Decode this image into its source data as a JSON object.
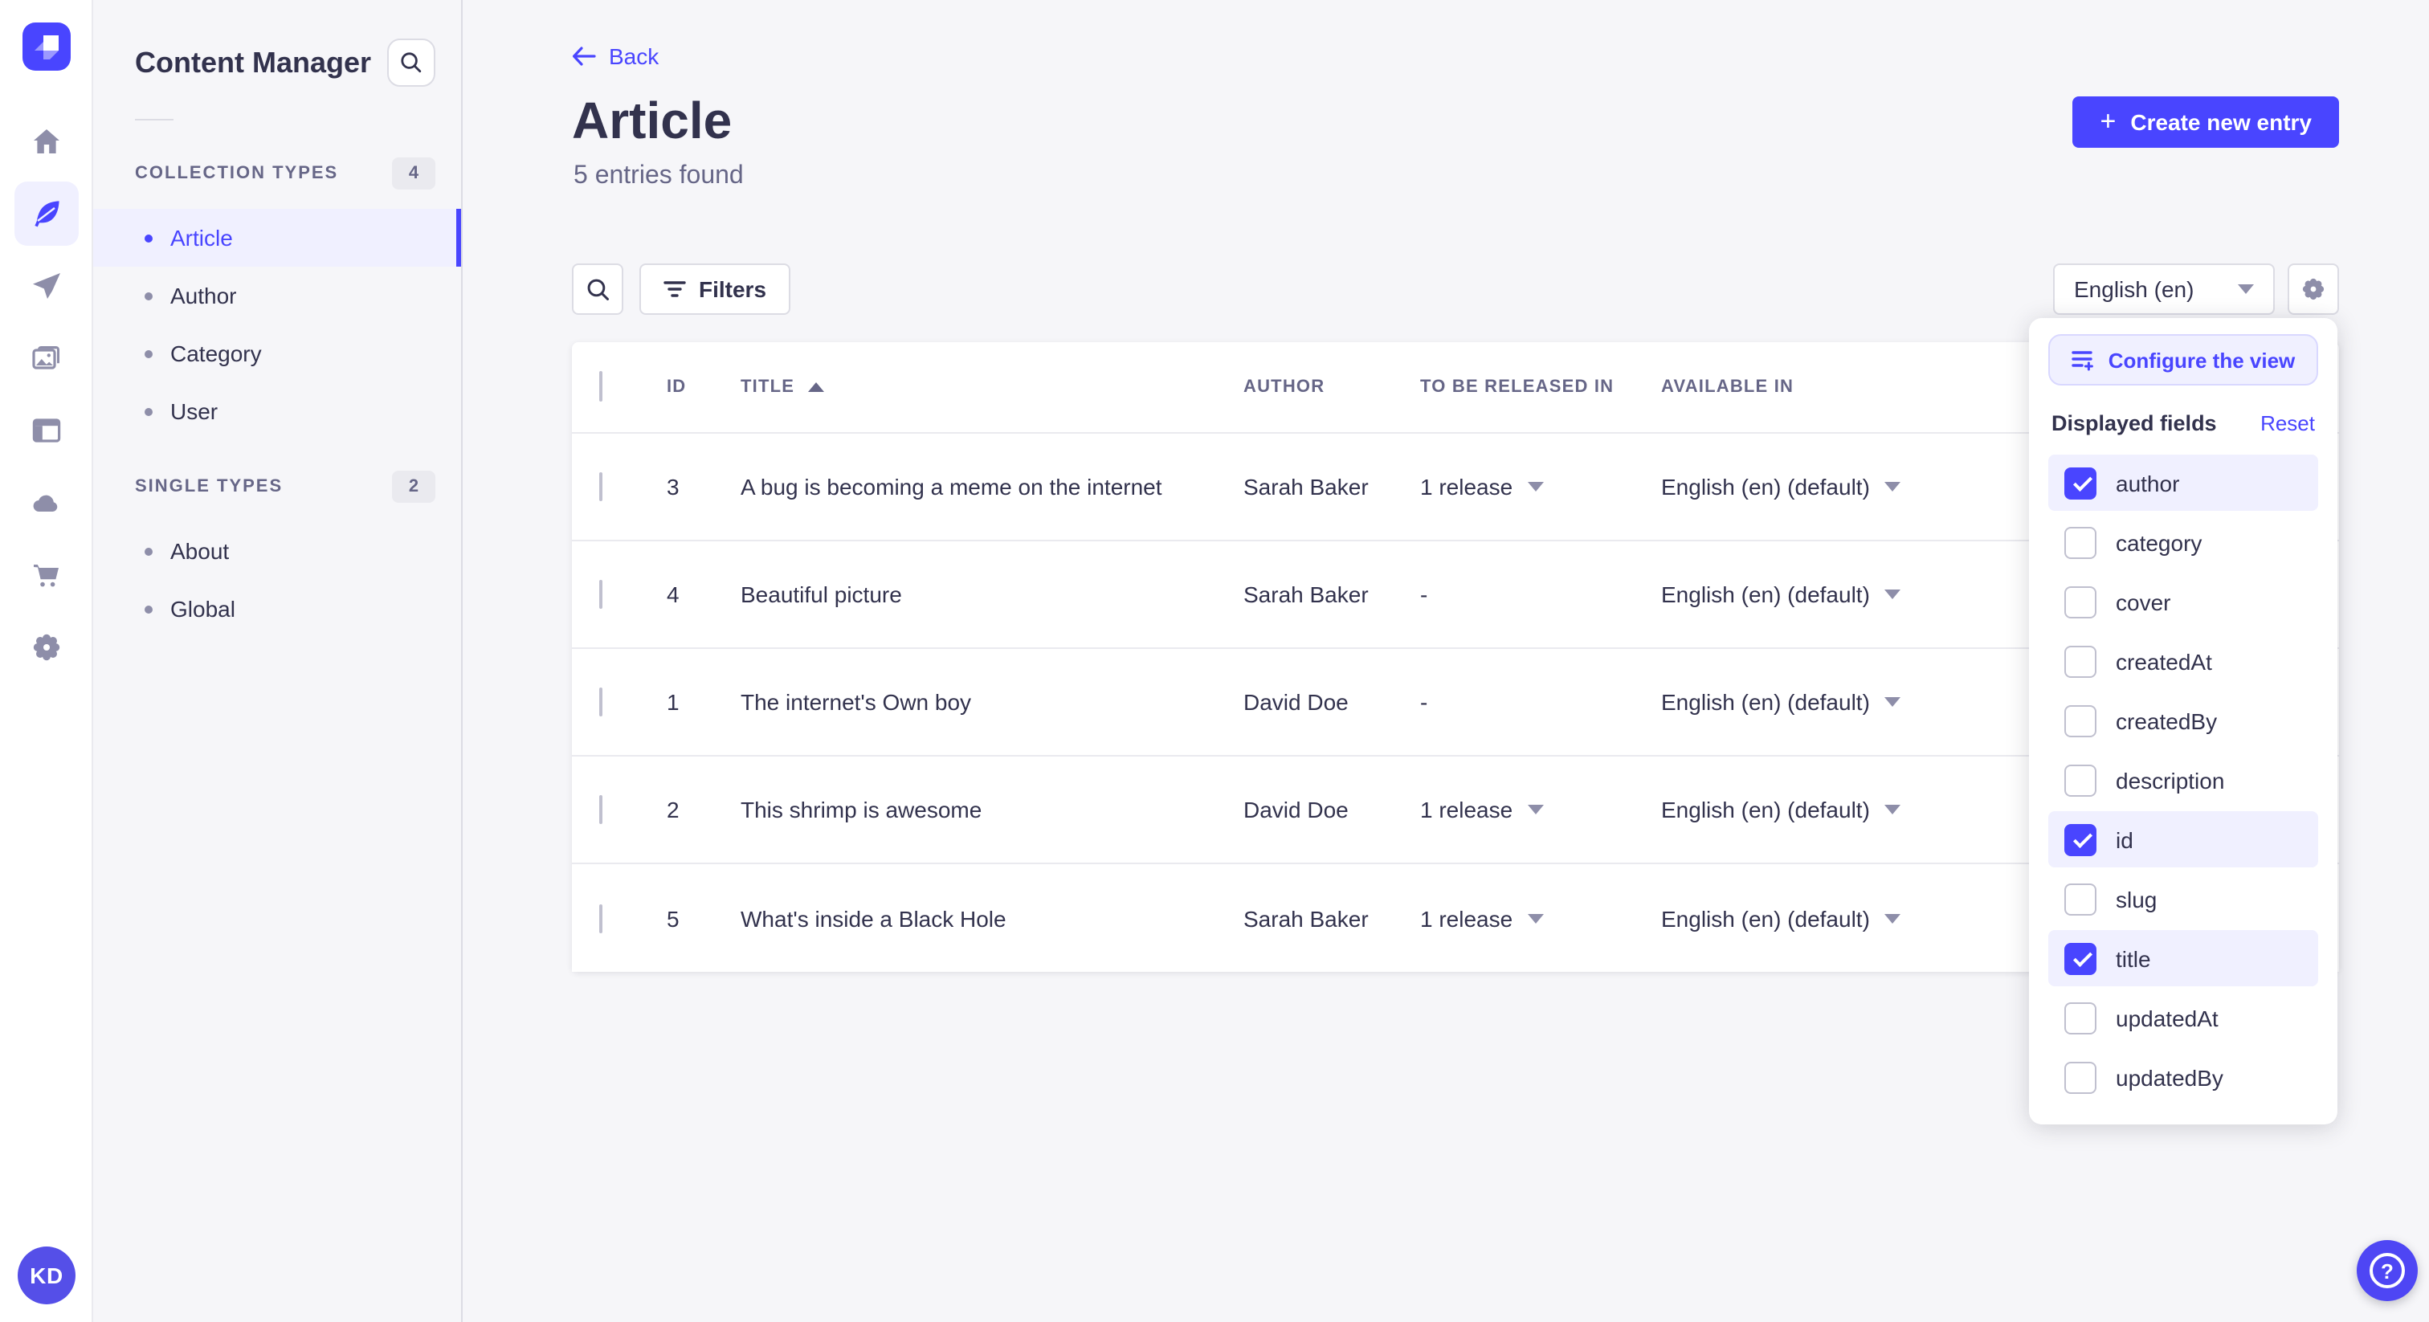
{
  "app": {
    "colors": {
      "primary": "#4945FF",
      "primary_light": "#F0F0FF",
      "text_dark": "#32324D",
      "text_muted": "#666687",
      "icon_gray": "#8E8EA9",
      "background": "#F6F6F9",
      "border": "#DCDCE4"
    }
  },
  "nav_rail": {
    "logo_icon": "strapi-logo",
    "items": [
      {
        "icon": "home-icon",
        "active": false
      },
      {
        "icon": "content-manager-feather-icon",
        "active": true
      },
      {
        "icon": "releases-paper-plane-icon",
        "active": false
      },
      {
        "icon": "media-library-icon",
        "active": false
      },
      {
        "icon": "content-type-builder-icon",
        "active": false
      },
      {
        "icon": "cloud-icon",
        "active": false
      },
      {
        "icon": "marketplace-cart-icon",
        "active": false
      },
      {
        "icon": "settings-gear-icon",
        "active": false
      }
    ],
    "avatar_initials": "KD"
  },
  "sidebar": {
    "title": "Content Manager",
    "sections": [
      {
        "label": "COLLECTION TYPES",
        "count": "4",
        "items": [
          {
            "label": "Article",
            "active": true
          },
          {
            "label": "Author",
            "active": false
          },
          {
            "label": "Category",
            "active": false
          },
          {
            "label": "User",
            "active": false
          }
        ]
      },
      {
        "label": "SINGLE TYPES",
        "count": "2",
        "items": [
          {
            "label": "About",
            "active": false
          },
          {
            "label": "Global",
            "active": false
          }
        ]
      }
    ]
  },
  "page": {
    "back_label": "Back",
    "title": "Article",
    "subtitle": "5 entries found",
    "create_button_label": "Create new entry"
  },
  "toolbar": {
    "filters_label": "Filters",
    "locale_value": "English (en)"
  },
  "table": {
    "columns": [
      "ID",
      "TITLE",
      "AUTHOR",
      "TO BE RELEASED IN",
      "AVAILABLE IN"
    ],
    "sorted_column": "TITLE",
    "sort_direction": "ascending",
    "rows": [
      {
        "id": "3",
        "title": "A bug is becoming a meme on the internet",
        "author": "Sarah Baker",
        "released_in": "1 release",
        "has_release": true,
        "available_in": "English (en) (default)"
      },
      {
        "id": "4",
        "title": "Beautiful picture",
        "author": "Sarah Baker",
        "released_in": "-",
        "has_release": false,
        "available_in": "English (en) (default)"
      },
      {
        "id": "1",
        "title": "The internet's Own boy",
        "author": "David Doe",
        "released_in": "-",
        "has_release": false,
        "available_in": "English (en) (default)"
      },
      {
        "id": "2",
        "title": "This shrimp is awesome",
        "author": "David Doe",
        "released_in": "1 release",
        "has_release": true,
        "available_in": "English (en) (default)"
      },
      {
        "id": "5",
        "title": "What's inside a Black Hole",
        "author": "Sarah Baker",
        "released_in": "1 release",
        "has_release": true,
        "available_in": "English (en) (default)"
      }
    ]
  },
  "popover": {
    "configure_button_label": "Configure the view",
    "section_title": "Displayed fields",
    "reset_label": "Reset",
    "fields": [
      {
        "label": "author",
        "checked": true
      },
      {
        "label": "category",
        "checked": false
      },
      {
        "label": "cover",
        "checked": false
      },
      {
        "label": "createdAt",
        "checked": false
      },
      {
        "label": "createdBy",
        "checked": false
      },
      {
        "label": "description",
        "checked": false
      },
      {
        "label": "id",
        "checked": true
      },
      {
        "label": "slug",
        "checked": false
      },
      {
        "label": "title",
        "checked": true
      },
      {
        "label": "updatedAt",
        "checked": false
      },
      {
        "label": "updatedBy",
        "checked": false
      }
    ]
  },
  "help": {
    "icon": "question-mark-icon"
  }
}
